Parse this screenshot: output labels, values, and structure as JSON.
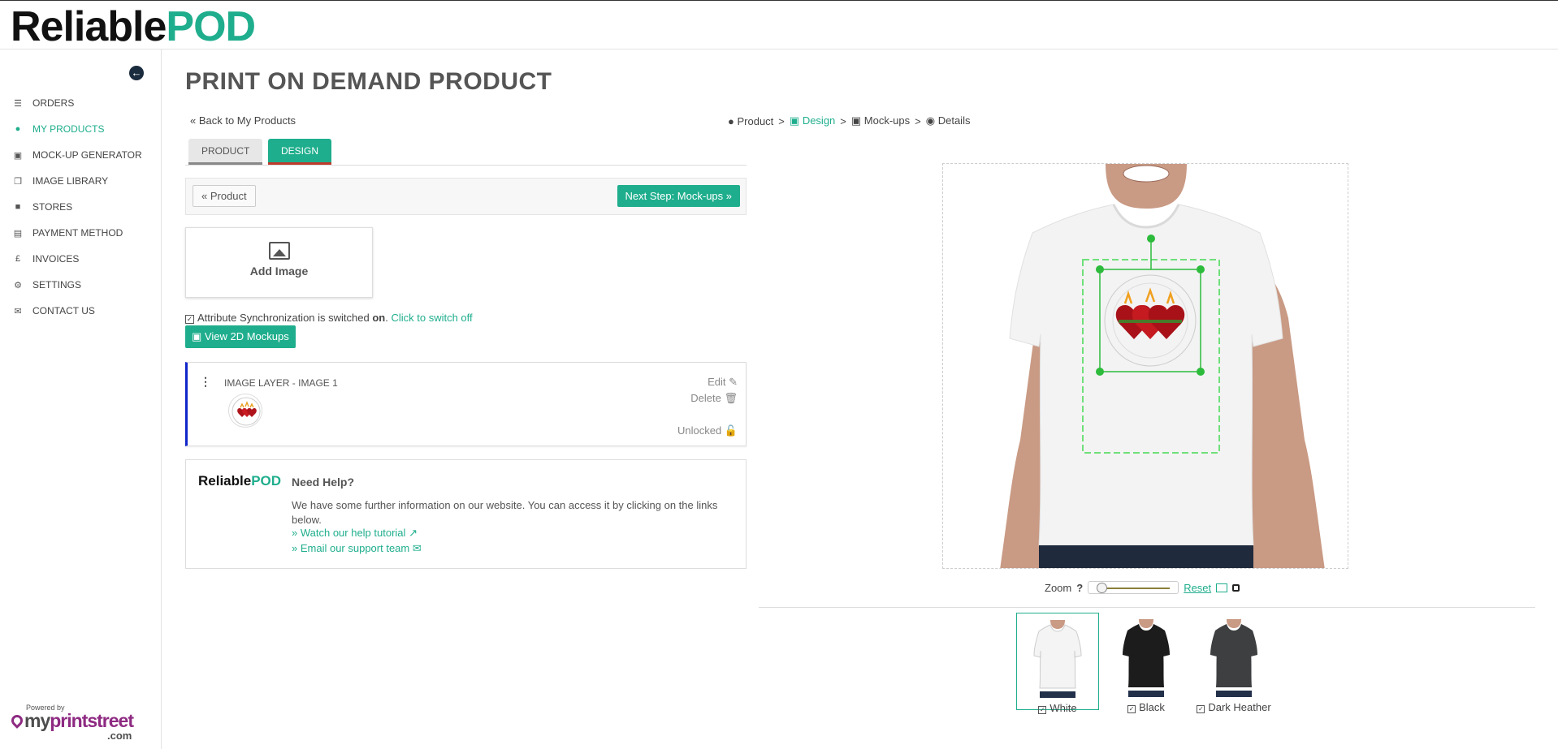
{
  "brand": {
    "part1": "Reliable",
    "part2": "POD",
    "accent": "#1fae8d"
  },
  "sidebar": {
    "items": [
      {
        "label": "ORDERS",
        "icon": "list-icon"
      },
      {
        "label": "MY PRODUCTS",
        "icon": "users-icon",
        "active": true
      },
      {
        "label": "MOCK-UP GENERATOR",
        "icon": "image-icon"
      },
      {
        "label": "IMAGE LIBRARY",
        "icon": "copy-icon"
      },
      {
        "label": "STORES",
        "icon": "cart-icon"
      },
      {
        "label": "PAYMENT METHOD",
        "icon": "credit-card-icon"
      },
      {
        "label": "INVOICES",
        "icon": "pound-icon"
      },
      {
        "label": "SETTINGS",
        "icon": "gear-icon"
      },
      {
        "label": "CONTACT US",
        "icon": "envelope-icon"
      }
    ],
    "powered_by": "Powered by",
    "footer_logo_part1": "my",
    "footer_logo_part2": "printstreet",
    "footer_logo_part3": ".com"
  },
  "page": {
    "title": "PRINT ON DEMAND PRODUCT",
    "back_link": "« Back to My Products"
  },
  "breadcrumb": {
    "items": [
      "Product",
      "Design",
      "Mock-ups",
      "Details"
    ],
    "separator": ">"
  },
  "tabs": {
    "product": "PRODUCT",
    "design": "DESIGN"
  },
  "steps": {
    "prev": "« Product",
    "next": "Next Step: Mock-ups »"
  },
  "add_image": {
    "label": "Add Image"
  },
  "sync": {
    "prefix": "Attribute Synchronization is switched ",
    "state": "on",
    "suffix": ".",
    "toggle": "Click to switch off"
  },
  "mockups_button": "View 2D Mockups",
  "layer": {
    "title": "IMAGE LAYER - IMAGE 1",
    "edit": "Edit",
    "delete": "Delete",
    "lock": "Unlocked"
  },
  "help": {
    "title": "Need Help?",
    "text": "We have some further information on our website. You can access it by clicking on the links below.",
    "link1": "» Watch our help tutorial",
    "link2": "» Email our support team"
  },
  "zoom": {
    "label": "Zoom",
    "help": "?",
    "reset": "Reset",
    "level": 0
  },
  "colors": [
    {
      "name": "White",
      "hex": "#ffffff",
      "selected": true
    },
    {
      "name": "Black",
      "hex": "#1c1c1c",
      "selected": false
    },
    {
      "name": "Dark Heather",
      "hex": "#3d3f40",
      "selected": false
    }
  ]
}
